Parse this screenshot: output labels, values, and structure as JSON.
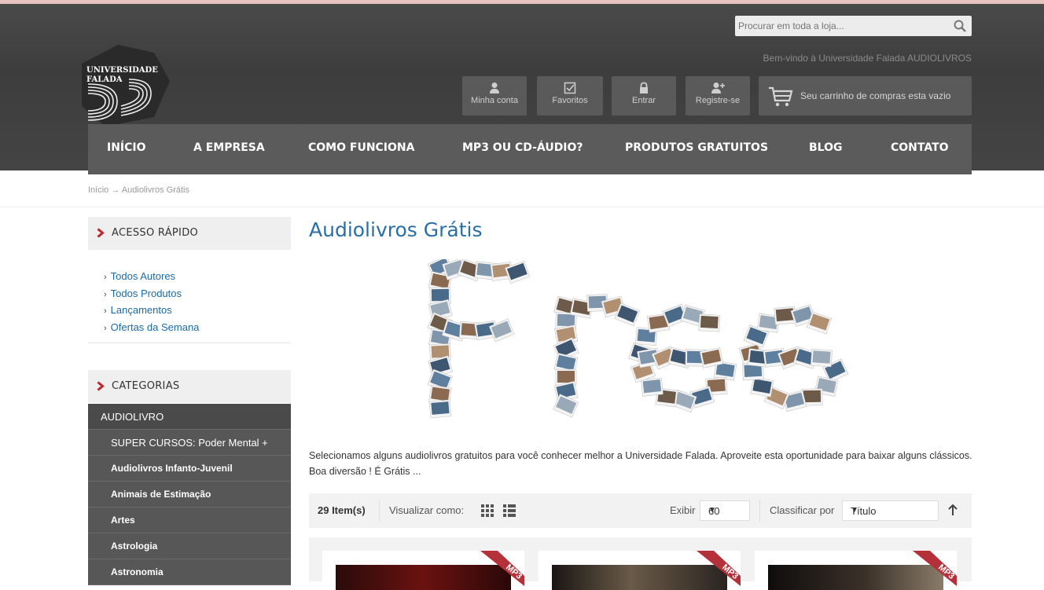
{
  "header": {
    "search_placeholder": "Procurar em toda a loja...",
    "welcome": "Bem-vindo à Universidade Falada AUDIOLIVROS",
    "logo_line1": "UNIVERSIDADE",
    "logo_line2": "FALADA",
    "buttons": [
      {
        "label": "Minha conta",
        "icon": "user-icon"
      },
      {
        "label": "Favoritos",
        "icon": "checkbox-icon"
      },
      {
        "label": "Entrar",
        "icon": "lock-icon"
      },
      {
        "label": "Registre-se",
        "icon": "user-add-icon"
      }
    ],
    "cart": "Seu carrinho de compras esta vazio"
  },
  "nav": [
    "INÍCIO",
    "A EMPRESA",
    "COMO FUNCIONA",
    "MP3 OU CD-ÁUDIO?",
    "PRODUTOS GRATUITOS",
    "BLOG",
    "CONTATO"
  ],
  "breadcrumb": "Início → Audiolivros Grátis",
  "sidebar": {
    "quick_title": "ACESSO RÁPIDO",
    "quick_links": [
      "Todos Autores",
      "Todos Produtos",
      "Lançamentos",
      "Ofertas da Semana"
    ],
    "categories_title": "CATEGORIAS",
    "categories": [
      "AUDIOLIVRO",
      "SUPER CURSOS: Poder Mental +",
      "Audiolivros Infanto-Juvenil",
      "Animais de Estimação",
      "Artes",
      "Astrologia",
      "Astronomia"
    ]
  },
  "main": {
    "title": "Audiolivros Grátis",
    "description": "Selecionamos alguns audiolivros gratuitos para você conhecer melhor a Universidade Falada. Aproveite esta oportunidade para baixar alguns clássicos. Boa diversão ! É Grátis ...",
    "toolbar": {
      "items": "29 Item(s)",
      "view_label": "Visualizar como:",
      "show_label": "Exibir",
      "show_value": "60",
      "sort_label": "Classificar por",
      "sort_value": "Título"
    },
    "ribbon": "MP3"
  },
  "colors": {
    "header_bg": "#444444",
    "nav_bg": "#5b5b5b",
    "link_blue": "#1a6aa8",
    "title_blue": "#2a6ea6",
    "accent_red": "#c0262c",
    "ribbon": "#b5313a"
  }
}
